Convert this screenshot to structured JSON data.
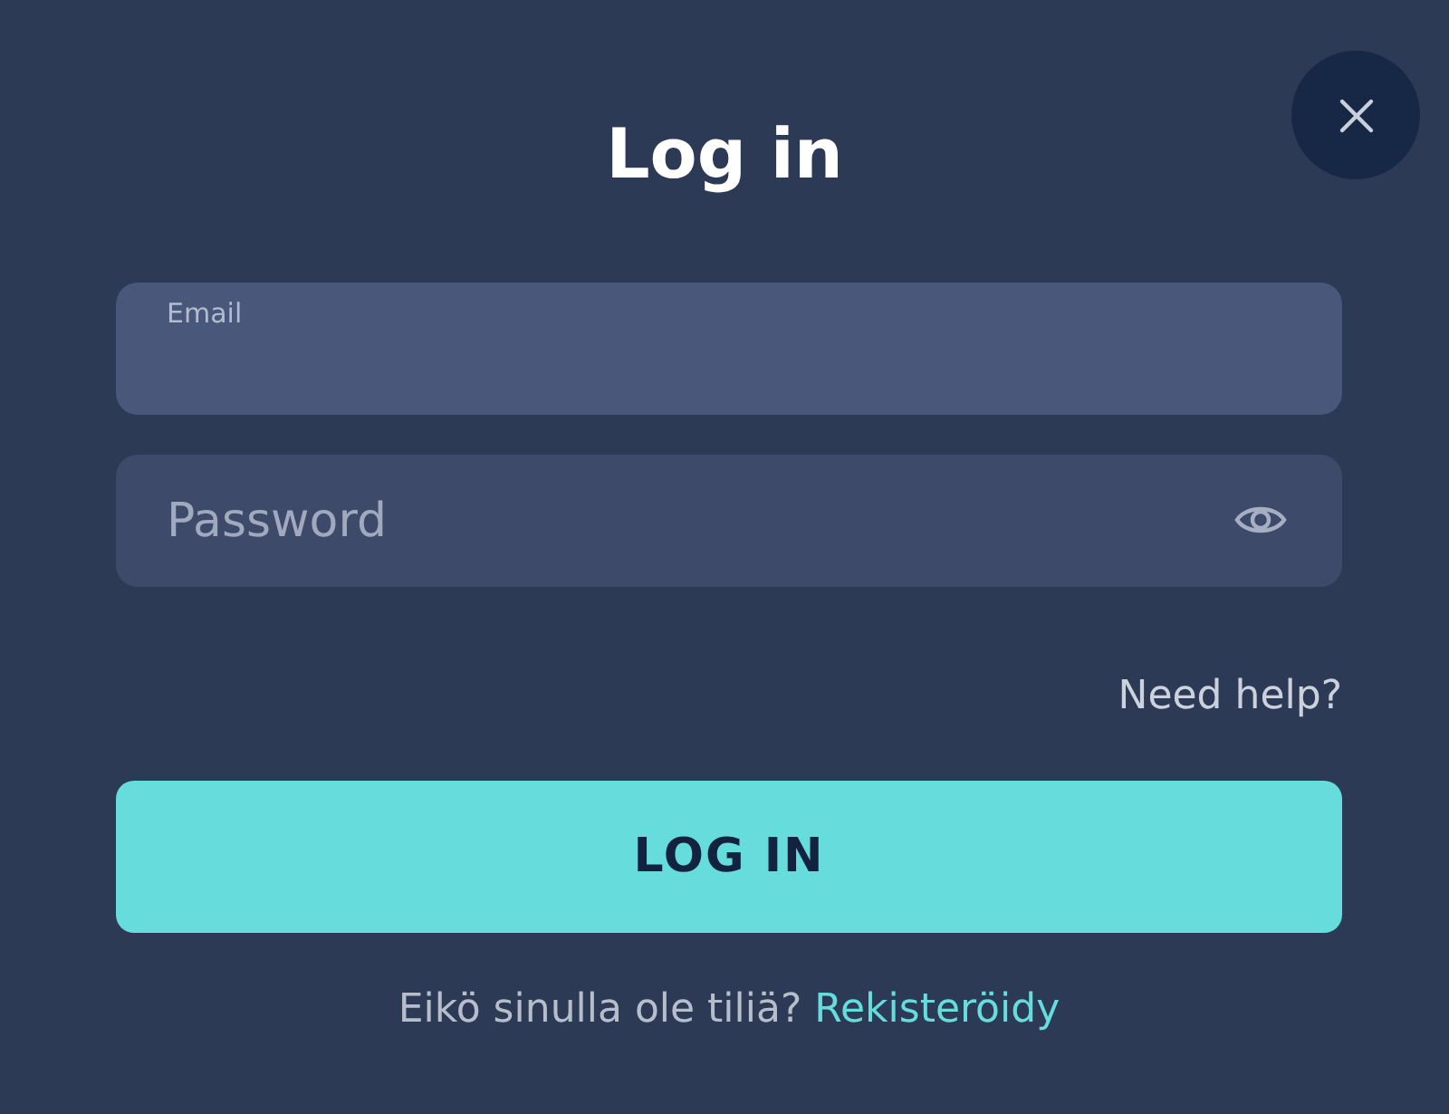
{
  "title": "Log in",
  "fields": [
    {
      "kind": "email",
      "label": "Email",
      "focused": true
    },
    {
      "kind": "password",
      "placeholder": "Password",
      "focused": false
    }
  ],
  "help_link": "Need help?",
  "submit_button": "LOG IN",
  "footer": {
    "text": "Eikö sinulla ole tiliä?",
    "link": "Rekisteröidy"
  }
}
